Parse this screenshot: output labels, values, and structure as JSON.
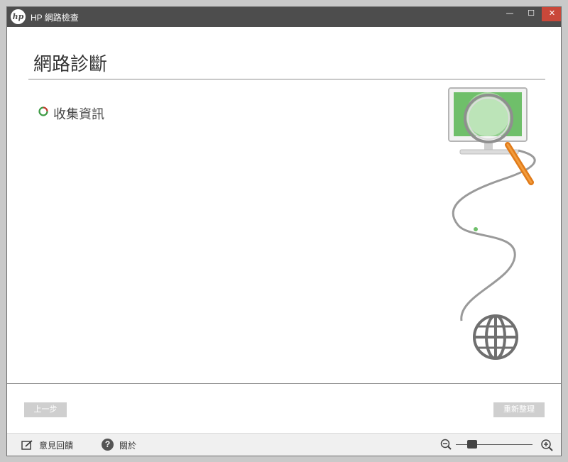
{
  "window": {
    "app_title": "HP 網路檢查",
    "logo_text": "hp",
    "minimize_glyph": "—",
    "maximize_glyph": "☐",
    "close_glyph": "✕"
  },
  "main": {
    "page_title": "網路診斷",
    "status_text": "收集資訊"
  },
  "nav": {
    "back_label": "上一步",
    "refresh_label": "重新整理"
  },
  "footer": {
    "feedback_label": "意見回饋",
    "about_label": "關於",
    "help_glyph": "?"
  },
  "colors": {
    "titlebar": "#4d4d4d",
    "close_button": "#c9483a",
    "accent_green": "#5cb85c",
    "magnifier_orange": "#e07b1a",
    "disabled_button": "#cfcfcf"
  },
  "icons": [
    "hp-logo",
    "spinner-icon",
    "monitor-icon",
    "magnifier-icon",
    "globe-icon",
    "feedback-icon",
    "help-icon",
    "zoom-out-icon",
    "zoom-in-icon"
  ]
}
